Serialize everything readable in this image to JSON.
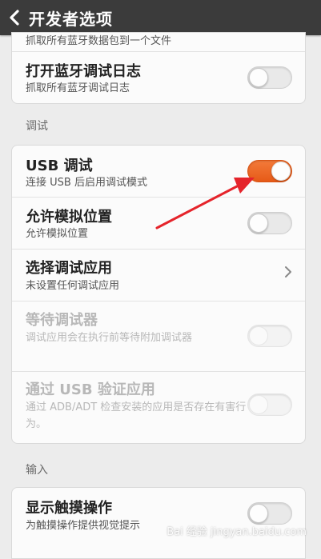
{
  "header": {
    "title": "开发者选项"
  },
  "card1": {
    "partial_sub": "抓取所有蓝牙数据包到一个文件",
    "bt_log_title": "打开蓝牙调试日志",
    "bt_log_sub": "抓取所有蓝牙调试日志"
  },
  "sections": {
    "debug": "调试",
    "input": "输入"
  },
  "debug_rows": {
    "usb_title": "USB 调试",
    "usb_sub": "连接 USB 后启用调试模式",
    "mock_title": "允许模拟位置",
    "mock_sub": "允许模拟位置",
    "select_app_title": "选择调试应用",
    "select_app_sub": "未设置任何调试应用",
    "wait_title": "等待调试器",
    "wait_sub": "调试应用会在执行前等待附加调试器",
    "verify_title": "通过 USB 验证应用",
    "verify_sub": "通过 ADB/ADT 检查安装的应用是否存在有害行为。"
  },
  "input_rows": {
    "touch_title": "显示触摸操作",
    "touch_sub": "为触摸操作提供视觉提示"
  },
  "toggles": {
    "bt_log": false,
    "usb_debug": true,
    "mock_location": false,
    "wait_debugger": false,
    "verify_usb": false,
    "show_touches": false
  },
  "colors": {
    "accent": "#e9621f",
    "arrow": "#e5242b",
    "header": "#3b3b3b"
  },
  "watermark": "Bai 经验 jingyan.baidu.com"
}
